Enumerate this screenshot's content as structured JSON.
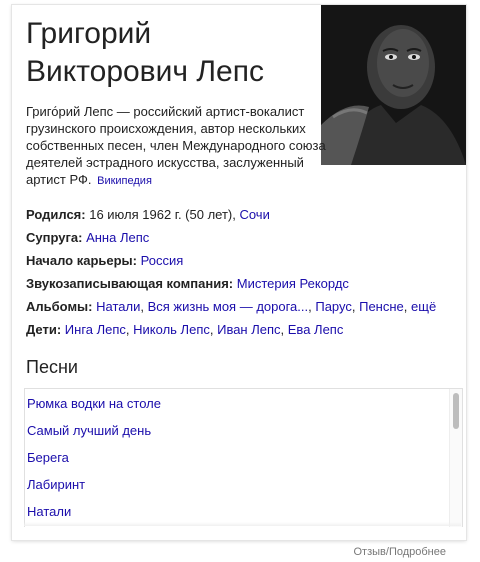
{
  "knowledge_panel": {
    "title": "Григорий Викторович Лепс",
    "description": "Григо́рий Лепс — российский артист-вокалист грузинского происхождения, автор нескольких собственных песен, член Международного союза деятелей эстрадного искусства, заслуженный артист РФ.",
    "source": "Википедия",
    "facts": {
      "born": {
        "label": "Родился:",
        "text": "16 июля 1962 г. (50 лет),",
        "link": "Сочи"
      },
      "spouse": {
        "label": "Супруга:",
        "link": "Анна Лепс"
      },
      "career_start": {
        "label": "Начало карьеры:",
        "link": "Россия"
      },
      "label_company": {
        "label": "Звукозаписывающая компания:",
        "link": "Мистерия Рекордс"
      },
      "albums": {
        "label": "Альбомы:",
        "links": [
          "Натали",
          "Вся жизнь моя — дорога...",
          "Парус",
          "Пенсне",
          "ещё"
        ]
      },
      "children": {
        "label": "Дети:",
        "links": [
          "Инга Лепс",
          "Николь Лепс",
          "Иван Лепс",
          "Ева Лепс"
        ]
      }
    },
    "songs": {
      "heading": "Песни",
      "items": [
        "Рюмка водки на столе",
        "Самый лучший день",
        "Берега",
        "Лабиринт",
        "Натали"
      ]
    },
    "footer_link": "Отзыв/Подробнее"
  },
  "colors": {
    "link": "#1a0dab",
    "text": "#222222",
    "muted": "#777777"
  }
}
